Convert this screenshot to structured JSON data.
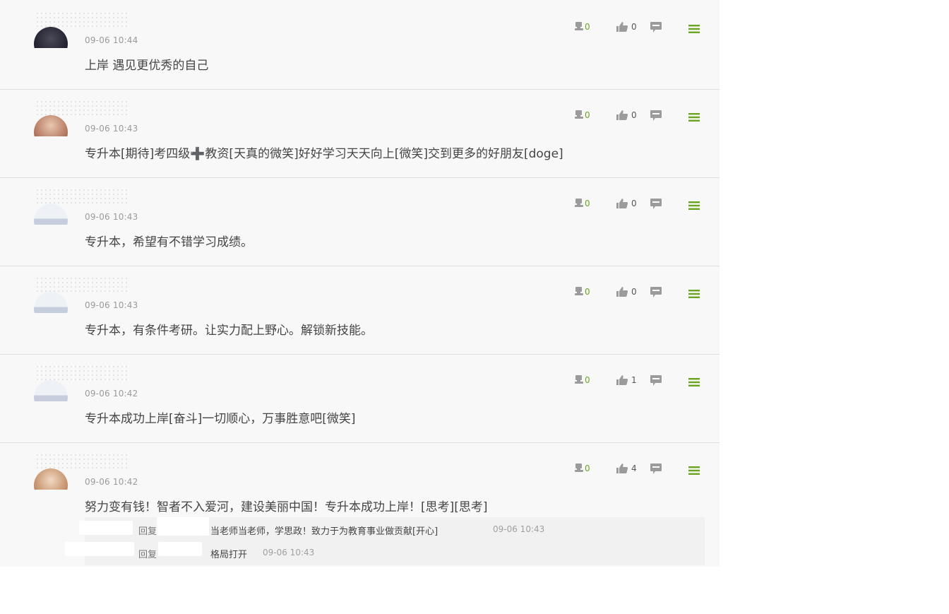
{
  "comments": [
    {
      "time": "09-06 10:44",
      "text": "上岸 遇见更优秀的自己",
      "report": "0",
      "likes": "0"
    },
    {
      "time": "09-06 10:43",
      "text": "专升本[期待]考四级➕教资[天真的微笑]好好学习天天向上[微笑]交到更多的好朋友[doge]",
      "report": "0",
      "likes": "0"
    },
    {
      "time": "09-06 10:43",
      "text": "专升本，希望有不错学习成绩。",
      "report": "0",
      "likes": "0"
    },
    {
      "time": "09-06 10:43",
      "text": "专升本，有条件考研。让实力配上野心。解锁新技能。",
      "report": "0",
      "likes": "0"
    },
    {
      "time": "09-06 10:42",
      "text": "专升本成功上岸[奋斗]一切顺心，万事胜意吧[微笑]",
      "report": "0",
      "likes": "1"
    },
    {
      "time": "09-06 10:42",
      "text": "努力变有钱！智者不入爱河，建设美丽中国！专升本成功上岸！[思考][思考]",
      "report": "0",
      "likes": "4"
    }
  ],
  "replies": [
    {
      "prefix": "回复",
      "text": "当老师当老师，学思政！致力于为教育事业做贡献[开心]",
      "time": "09-06 10:43"
    },
    {
      "prefix": "回复",
      "text": "格局打开",
      "time": "09-06 10:43"
    }
  ],
  "icons": {
    "report": "report-icon",
    "like": "thumbs-up-icon",
    "reply": "reply-bubble-icon",
    "menu": "hamburger-menu-icon"
  },
  "colors": {
    "accent_green": "#6aa520",
    "icon_gray": "#9b9b9b",
    "background": "#f8f8f8"
  }
}
